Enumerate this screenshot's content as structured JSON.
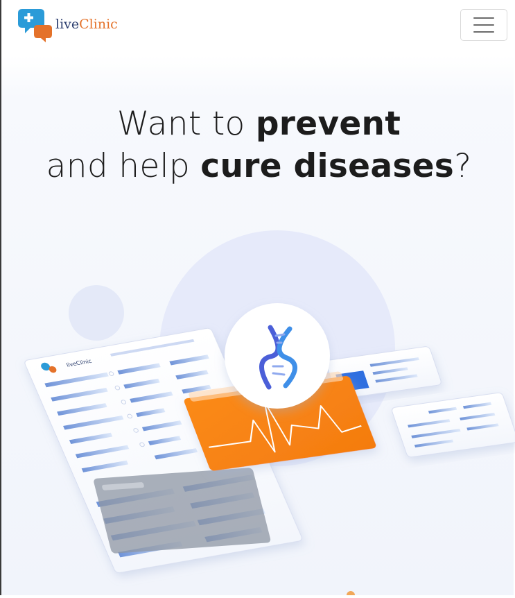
{
  "brand": {
    "name_part1": "live",
    "name_part2": "Clinic",
    "colors": {
      "blue": "#2b9bd8",
      "orange": "#e4722a",
      "text": "#2a3c6d"
    }
  },
  "nav": {
    "toggle_icon": "hamburger-menu-icon"
  },
  "hero": {
    "title": {
      "line1_light": "Want to ",
      "line1_bold": "prevent",
      "line2_light": "and help ",
      "line2_bold": "cure diseases",
      "line2_end": "?"
    },
    "illustration": {
      "icons": [
        "dna-icon",
        "heartbeat-icon"
      ],
      "dashboard_logo_text": "liveClinic",
      "accent_color": "#f7861d"
    }
  }
}
